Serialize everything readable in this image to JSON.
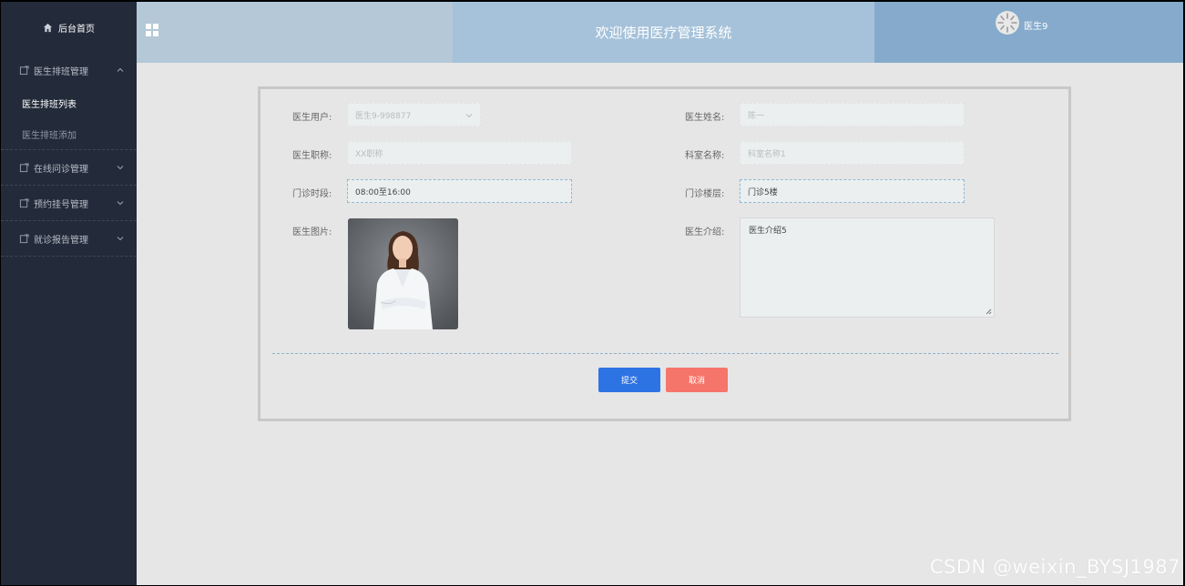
{
  "sidebar": {
    "home_label": "后台首页",
    "groups": [
      {
        "label": "医生排班管理",
        "expanded": true,
        "items": [
          {
            "label": "医生排班列表",
            "active": true
          },
          {
            "label": "医生排班添加",
            "active": false
          }
        ]
      },
      {
        "label": "在线问诊管理",
        "expanded": false
      },
      {
        "label": "预约挂号管理",
        "expanded": false
      },
      {
        "label": "就诊报告管理",
        "expanded": false
      }
    ]
  },
  "header": {
    "title": "欢迎使用医疗管理系统",
    "username": "医生9"
  },
  "form": {
    "doctor_user": {
      "label": "医生用户:",
      "value": "医生9-998877"
    },
    "doctor_name": {
      "label": "医生姓名:",
      "placeholder": "陈一"
    },
    "doctor_title": {
      "label": "医生职称:",
      "placeholder": "XX职称"
    },
    "department": {
      "label": "科室名称:",
      "placeholder": "科室名称1"
    },
    "clinic_hours": {
      "label": "门诊时段:",
      "value": "08:00至16:00"
    },
    "clinic_floor": {
      "label": "门诊楼层:",
      "value": "门诊5楼"
    },
    "doctor_photo": {
      "label": "医生图片:"
    },
    "doctor_intro": {
      "label": "医生介绍:",
      "value": "医生介绍5"
    }
  },
  "buttons": {
    "submit": "提交",
    "cancel": "取消"
  },
  "watermark": "CSDN @weixin_BYSJ1987",
  "colors": {
    "sidebar_bg": "#232b3a",
    "submit": "#2e73e4",
    "cancel": "#f6756a",
    "header_left": "#b4c8d7",
    "header_mid": "#a6c2da",
    "header_right": "#85aacc"
  }
}
